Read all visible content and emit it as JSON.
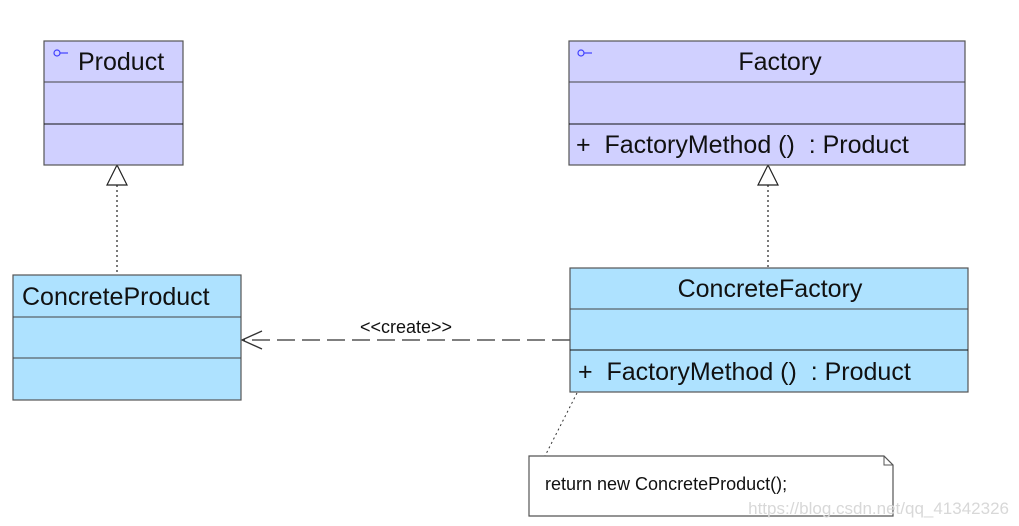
{
  "colors": {
    "abstract_fill": "#d0d0ff",
    "concrete_fill": "#aee2ff",
    "border": "#444444"
  },
  "classes": {
    "product": {
      "name": "Product",
      "icon": "interface-icon"
    },
    "factory": {
      "name": "Factory",
      "icon": "interface-icon",
      "operation": "+  FactoryMethod ()  : Product"
    },
    "concrete_product": {
      "name": "ConcreteProduct"
    },
    "concrete_factory": {
      "name": "ConcreteFactory",
      "operation": "+  FactoryMethod ()  : Product"
    }
  },
  "relations": {
    "create_label": "<<create>>"
  },
  "note": {
    "text": "return new ConcreteProduct();"
  },
  "watermark": "https://blog.csdn.net/qq_41342326"
}
